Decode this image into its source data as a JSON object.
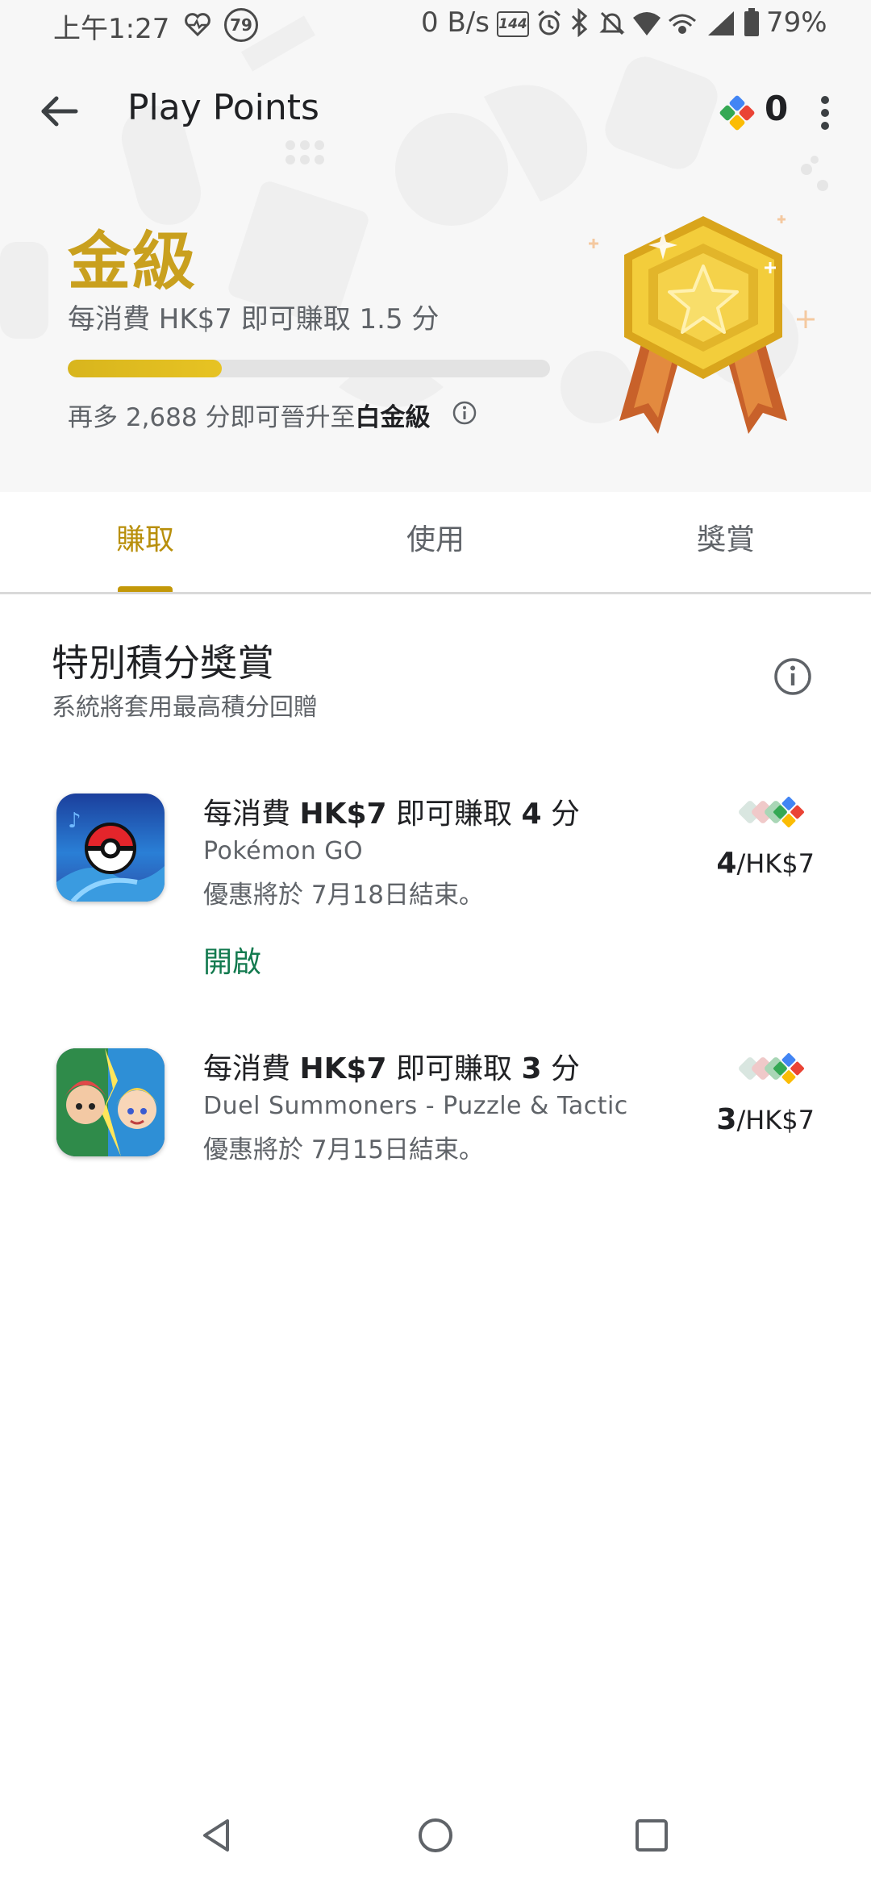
{
  "status_bar": {
    "time": "上午1:27",
    "badge_number": "79",
    "net_speed": "0 B/s",
    "refresh_rate": "144",
    "battery": "79%"
  },
  "app_bar": {
    "title": "Play Points",
    "points": "0"
  },
  "tier": {
    "name": "金級",
    "rate": "每消費 HK$7 即可賺取 1.5 分",
    "progress": 0.32,
    "next_prefix": "再多 2,688 分即可晉升至",
    "next_tier": "白金級"
  },
  "tabs": [
    {
      "label": "賺取",
      "selected": true
    },
    {
      "label": "使用",
      "selected": false
    },
    {
      "label": "獎賞",
      "selected": false
    }
  ],
  "section": {
    "title": "特別積分獎賞",
    "subtitle": "系統將套用最高積分回贈"
  },
  "offers": [
    {
      "title_prefix": "每消費 ",
      "title_amount": "HK$7",
      "title_mid": " 即可賺取 ",
      "title_points": "4",
      "title_suffix": " 分",
      "app": "Pokémon GO",
      "end": "優惠將於 7月18日結束。",
      "rate_value": "4",
      "rate_unit": "/HK$7",
      "action": "開啟"
    },
    {
      "title_prefix": "每消費 ",
      "title_amount": "HK$7",
      "title_mid": " 即可賺取 ",
      "title_points": "3",
      "title_suffix": " 分",
      "app": "Duel Summoners - Puzzle & Tactic",
      "end": "優惠將於 7月15日結束。",
      "rate_value": "3",
      "rate_unit": "/HK$7"
    }
  ],
  "colors": {
    "gold_accent": "#c9a01e",
    "tab_selected": "#b88f0a",
    "action_green": "#137a4f"
  },
  "icons": {
    "back": "arrow-left",
    "points": "play-points-diamond",
    "more": "vertical-ellipsis",
    "info": "info-circle",
    "nav_back": "triangle-left",
    "nav_home": "circle",
    "nav_recents": "square"
  }
}
